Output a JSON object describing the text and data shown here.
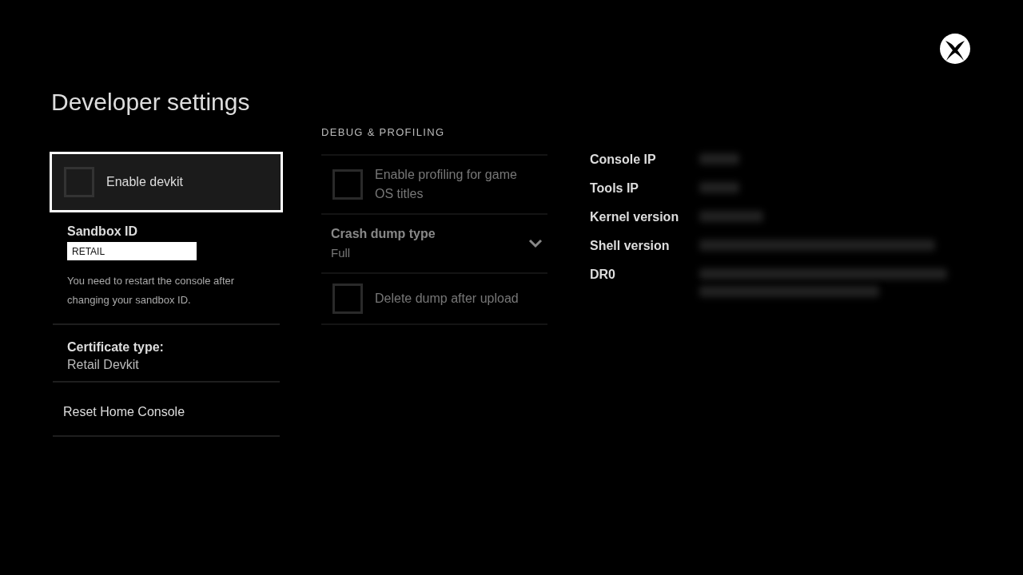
{
  "title": "Developer settings",
  "left_column": {
    "devkit": {
      "label": "Enable devkit",
      "checked": false,
      "focused": true
    },
    "sandbox": {
      "label": "Sandbox ID",
      "value": "RETAIL",
      "hint": "You need to restart the console after changing your sandbox ID."
    },
    "certificate": {
      "label": "Certificate type:",
      "value": "Retail Devkit"
    },
    "reset": {
      "label": "Reset Home Console"
    }
  },
  "debug_section": {
    "heading": "DEBUG & PROFILING",
    "items": [
      {
        "kind": "checkbox",
        "label": "Enable profiling for game OS titles",
        "checked": false,
        "disabled": true
      },
      {
        "kind": "dropdown",
        "label": "Crash dump type",
        "value": "Full",
        "disabled": true
      },
      {
        "kind": "checkbox",
        "label": "Delete dump after upload",
        "checked": false,
        "disabled": true
      }
    ]
  },
  "info": [
    {
      "label": "Console IP"
    },
    {
      "label": "Tools IP"
    },
    {
      "label": "Kernel version"
    },
    {
      "label": "Shell version"
    },
    {
      "label": "DR0"
    }
  ]
}
